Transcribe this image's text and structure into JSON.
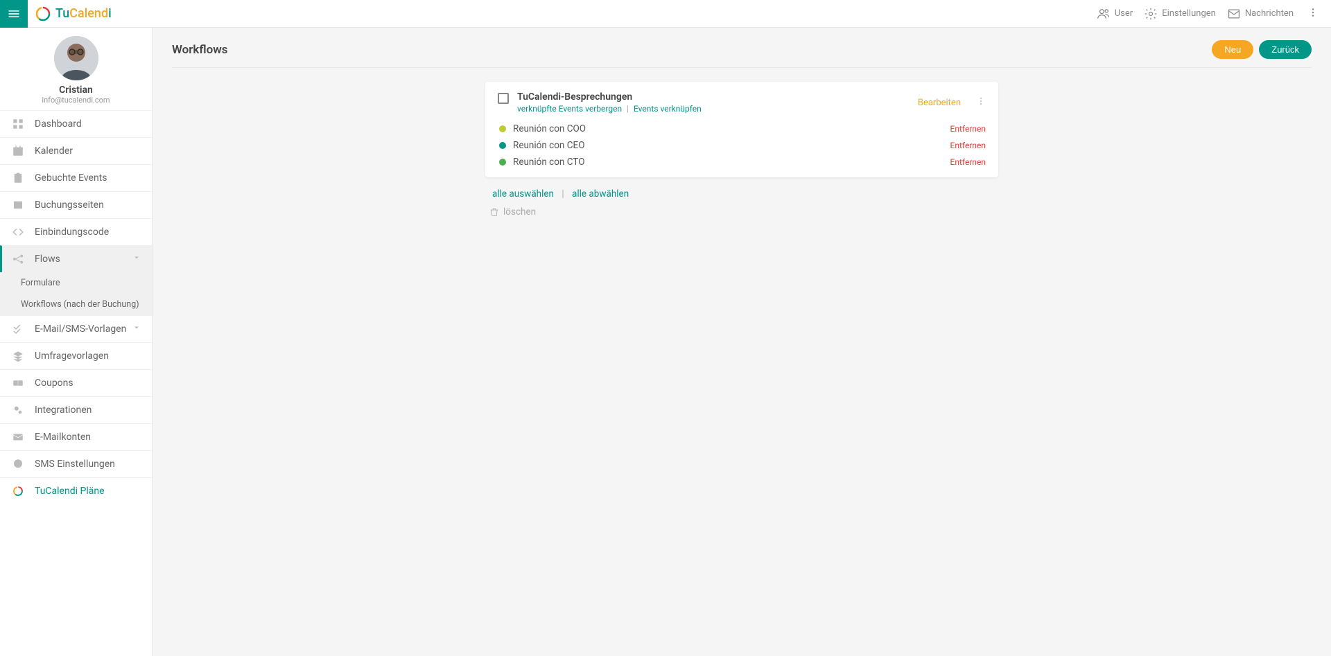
{
  "brand": {
    "part1": "Tu",
    "part2": "Calend",
    "part3": "i"
  },
  "top": {
    "user": "User",
    "settings": "Einstellungen",
    "messages": "Nachrichten"
  },
  "profile": {
    "name": "Cristian",
    "email": "info@tucalendi.com"
  },
  "nav": {
    "dashboard": "Dashboard",
    "kalender": "Kalender",
    "gebuchte": "Gebuchte Events",
    "buchungsseiten": "Buchungsseiten",
    "einbindung": "Einbindungscode",
    "flows": "Flows",
    "flows_sub1": "Formulare",
    "flows_sub2": "Workflows (nach der Buchung)",
    "email_sms": "E-Mail/SMS-Vorlagen",
    "umfrage": "Umfragevorlagen",
    "coupons": "Coupons",
    "integrationen": "Integrationen",
    "emailkonten": "E-Mailkonten",
    "sms_settings": "SMS Einstellungen",
    "plaene": "TuCalendi Pläne"
  },
  "page": {
    "title": "Workflows",
    "btn_new": "Neu",
    "btn_back": "Zurück"
  },
  "card": {
    "title": "TuCalendi-Besprechungen",
    "link_hide": "verknüpfte Events verbergen",
    "link_link": "Events verknüpfen",
    "edit": "Bearbeiten",
    "events": [
      {
        "name": "Reunión con COO",
        "color": "#c0ca33",
        "remove": "Entfernen"
      },
      {
        "name": "Reunión con CEO",
        "color": "#009688",
        "remove": "Entfernen"
      },
      {
        "name": "Reunión con CTO",
        "color": "#4caf50",
        "remove": "Entfernen"
      }
    ]
  },
  "bulk": {
    "select_all": "alle auswählen",
    "deselect_all": "alle abwählen",
    "delete": "löschen"
  }
}
